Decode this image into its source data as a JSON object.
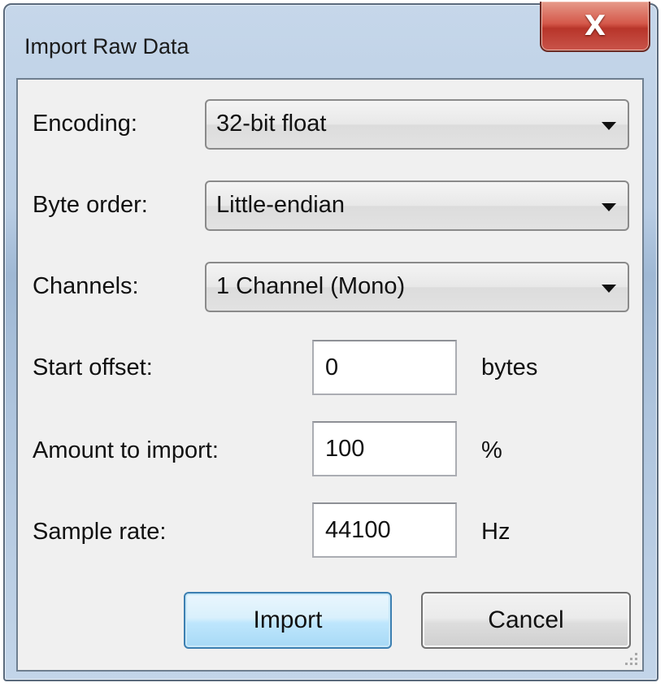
{
  "window": {
    "title": "Import Raw Data",
    "close_label": "X"
  },
  "form": {
    "encoding": {
      "label": "Encoding:",
      "value": "32-bit float"
    },
    "byte_order": {
      "label": "Byte order:",
      "value": "Little-endian"
    },
    "channels": {
      "label": "Channels:",
      "value": "1 Channel (Mono)"
    },
    "start_offset": {
      "label": "Start offset:",
      "value": "0",
      "unit": "bytes"
    },
    "amount": {
      "label": "Amount to import:",
      "value": "100",
      "unit": "%"
    },
    "sample_rate": {
      "label": "Sample rate:",
      "value": "44100",
      "unit": "Hz"
    }
  },
  "buttons": {
    "import_label": "Import",
    "cancel_label": "Cancel"
  },
  "icons": {
    "close": "close-icon",
    "dropdown": "chevron-down-icon",
    "resize": "resize-grip-icon"
  }
}
